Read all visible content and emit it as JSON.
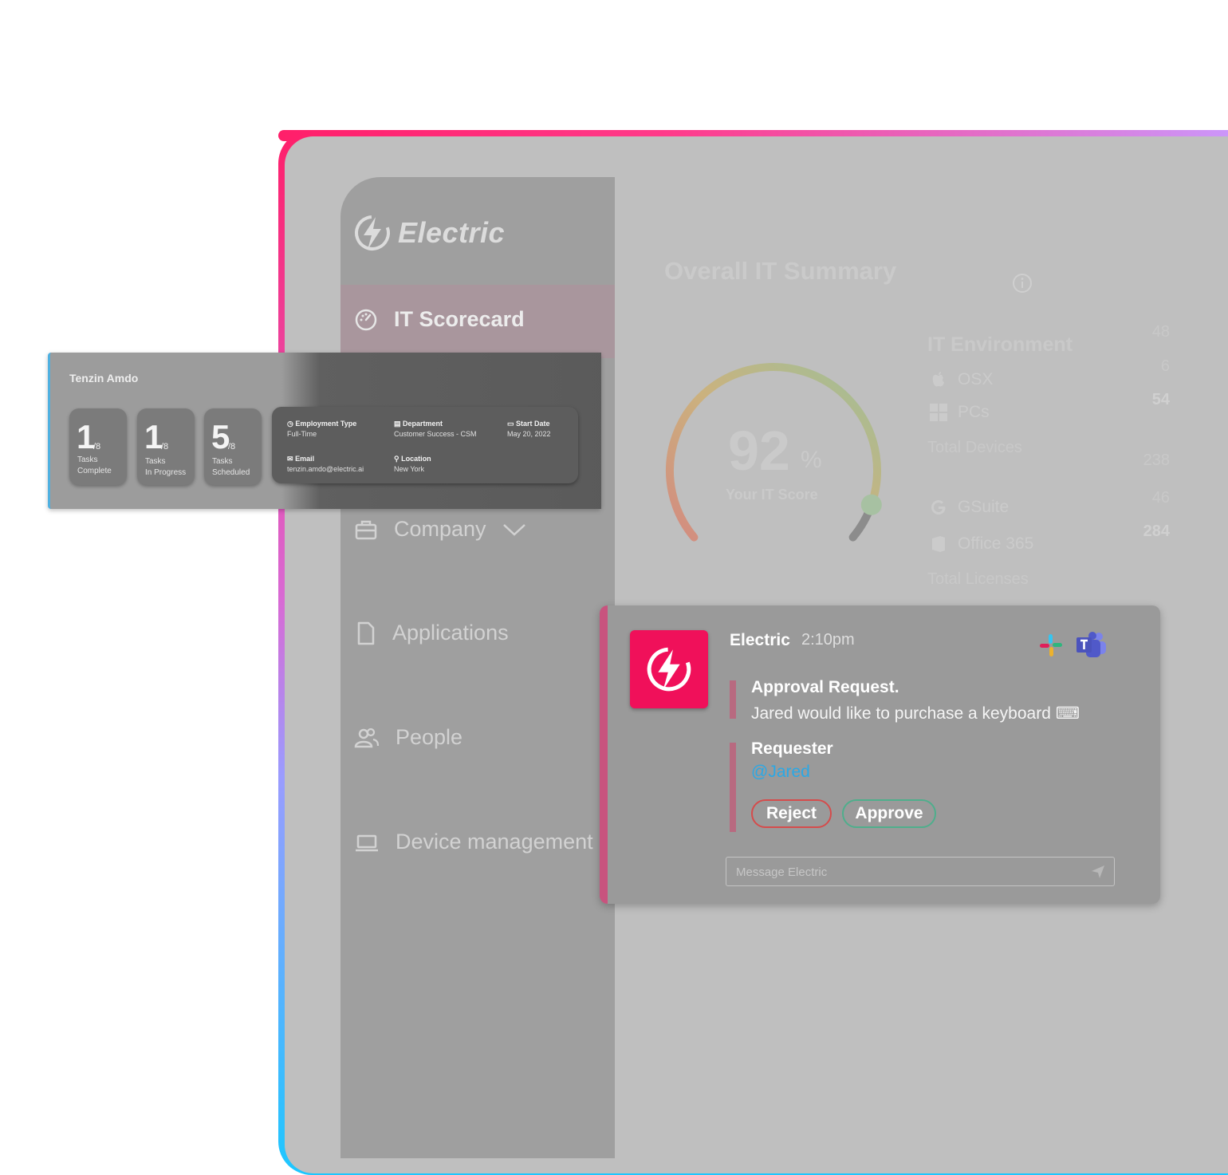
{
  "brand": {
    "name": "Electric"
  },
  "nav": {
    "items": [
      {
        "label": "IT Scorecard",
        "icon": "gauge-icon",
        "active": true
      },
      {
        "label": "Company",
        "icon": "briefcase-icon",
        "expandable": true
      },
      {
        "label": "Applications",
        "icon": "document-icon"
      },
      {
        "label": "People",
        "icon": "people-icon"
      },
      {
        "label": "Device management",
        "icon": "laptop-icon"
      }
    ]
  },
  "summary": {
    "title": "Overall IT Summary",
    "score": {
      "value": "92",
      "unit": "%",
      "label": "Your IT Score",
      "fraction": 0.92
    },
    "environment": {
      "title": "IT Environment",
      "osx": {
        "label": "OSX",
        "value": "48"
      },
      "pcs": {
        "label": "PCs",
        "value": "6"
      },
      "total_devices": {
        "label": "Total Devices",
        "value": "54"
      },
      "gsuite": {
        "label": "GSuite",
        "value": "238"
      },
      "office365": {
        "label": "Office 365",
        "value": "46"
      },
      "total_licenses": {
        "label": "Total Licenses",
        "value": "284"
      }
    }
  },
  "profile": {
    "name": "Tenzin Amdo",
    "tasks": [
      {
        "num": "1",
        "den": "/8",
        "line1": "Tasks",
        "line2": "Complete"
      },
      {
        "num": "1",
        "den": "/8",
        "line1": "Tasks",
        "line2": "In Progress"
      },
      {
        "num": "5",
        "den": "/8",
        "line1": "Tasks",
        "line2": "Scheduled"
      }
    ],
    "details": {
      "employment_type": {
        "label": "Employment Type",
        "value": "Full-Time"
      },
      "department": {
        "label": "Department",
        "value": "Customer Success - CSM"
      },
      "start_date": {
        "label": "Start Date",
        "value": "May 20, 2022"
      },
      "email": {
        "label": "Email",
        "value": "tenzin.amdo@electric.ai"
      },
      "location": {
        "label": "Location",
        "value": "New York"
      }
    }
  },
  "message": {
    "sender": "Electric",
    "time": "2:10pm",
    "request_title": "Approval Request.",
    "request_text": "Jared would like to purchase a keyboard ⌨",
    "requester_label": "Requester",
    "requester": "@Jared",
    "reject_label": "Reject",
    "approve_label": "Approve",
    "compose_placeholder": "Message Electric",
    "integrations": [
      "slack-icon",
      "teams-icon"
    ]
  },
  "colors": {
    "accent": "#f0105a",
    "reject": "#d54c4c",
    "approve": "#4fae8c",
    "mention": "#2aa8e6"
  }
}
